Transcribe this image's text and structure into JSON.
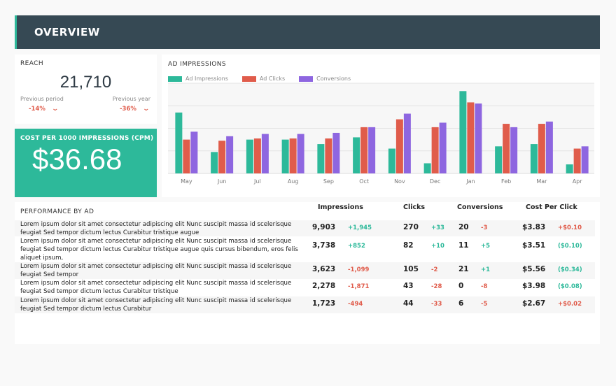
{
  "header": {
    "title": "OVERVIEW"
  },
  "reach": {
    "label": "REACH",
    "value": "21,710",
    "previous_period_label": "Previous period",
    "previous_period_change": "-14%",
    "previous_year_label": "Previous year",
    "previous_year_change": "-36%",
    "trend_icon": "chevron-down-icon"
  },
  "cpm": {
    "label": "COST PER 1000 IMPRESSIONS (CPM)",
    "value": "$36.68"
  },
  "colors": {
    "impressions": "#2db99a",
    "clicks": "#e05c4b",
    "conversions": "#8e66e0",
    "header_bg": "#364954",
    "negative": "#e05c4b",
    "positive": "#2db99a"
  },
  "chart_data": {
    "type": "bar",
    "title": "AD IMPRESSIONS",
    "xlabel": "",
    "ylabel": "",
    "categories": [
      "May",
      "Jun",
      "Jul",
      "Aug",
      "Sep",
      "Oct",
      "Nov",
      "Dec",
      "Jan",
      "Feb",
      "Mar",
      "Apr"
    ],
    "series": [
      {
        "name": "Ad Impressions",
        "color": "#2db99a",
        "values": [
          2.7,
          0.95,
          1.5,
          1.5,
          1.3,
          1.6,
          1.1,
          0.45,
          3.65,
          1.2,
          1.3,
          0.4
        ]
      },
      {
        "name": "Ad Clicks",
        "color": "#e05c4b",
        "values": [
          1.5,
          1.45,
          1.55,
          1.55,
          1.55,
          2.05,
          2.4,
          2.05,
          3.15,
          2.2,
          2.2,
          1.1
        ]
      },
      {
        "name": "Conversions",
        "color": "#8e66e0",
        "values": [
          1.85,
          1.65,
          1.75,
          1.75,
          1.8,
          2.05,
          2.65,
          2.25,
          3.1,
          2.05,
          2.3,
          1.2
        ]
      }
    ],
    "ylim": [
      0,
      4
    ],
    "y_ticks_shown": false,
    "grid": true,
    "legend": "top-left"
  },
  "performance": {
    "label": "PERFORMANCE BY AD",
    "columns": [
      "Impressions",
      "Clicks",
      "Conversions",
      "Cost Per Click"
    ],
    "rows": [
      {
        "description": "Lorem ipsum dolor sit amet consectetur adipiscing elit Nunc suscipit massa id scelerisque feugiat Sed tempor dictum lectus Curabitur tristique augue",
        "impressions": "9,903",
        "impressions_change": "+1,945",
        "impressions_trend": "pos",
        "clicks": "270",
        "clicks_change": "+33",
        "clicks_trend": "pos",
        "conversions": "20",
        "conversions_change": "-3",
        "conversions_trend": "neg",
        "cpc": "$3.83",
        "cpc_change": "+$0.10",
        "cpc_trend": "neg"
      },
      {
        "description": "Lorem ipsum dolor sit amet consectetur adipiscing elit Nunc suscipit massa id scelerisque feugiat Sed tempor dictum lectus Curabitur tristique augue quis cursus bibendum, eros felis aliquet ipsum,",
        "impressions": "3,738",
        "impressions_change": "+852",
        "impressions_trend": "pos",
        "clicks": "82",
        "clicks_change": "+10",
        "clicks_trend": "pos",
        "conversions": "11",
        "conversions_change": "+5",
        "conversions_trend": "pos",
        "cpc": "$3.51",
        "cpc_change": "($0.10)",
        "cpc_trend": "pos"
      },
      {
        "description": "Lorem ipsum dolor sit amet consectetur adipiscing elit Nunc suscipit massa id scelerisque feugiat Sed tempor",
        "impressions": "3,623",
        "impressions_change": "-1,099",
        "impressions_trend": "neg",
        "clicks": "105",
        "clicks_change": "-2",
        "clicks_trend": "neg",
        "conversions": "21",
        "conversions_change": "+1",
        "conversions_trend": "pos",
        "cpc": "$5.56",
        "cpc_change": "($0.34)",
        "cpc_trend": "pos"
      },
      {
        "description": "Lorem ipsum dolor sit amet consectetur adipiscing elit Nunc suscipit massa id scelerisque feugiat Sed tempor dictum lectus Curabitur tristique",
        "impressions": "2,278",
        "impressions_change": "-1,871",
        "impressions_trend": "neg",
        "clicks": "43",
        "clicks_change": "-28",
        "clicks_trend": "neg",
        "conversions": "0",
        "conversions_change": "-8",
        "conversions_trend": "neg",
        "cpc": "$3.98",
        "cpc_change": "($0.08)",
        "cpc_trend": "pos"
      },
      {
        "description": "Lorem ipsum dolor sit amet consectetur adipiscing elit Nunc suscipit massa id scelerisque feugiat Sed tempor dictum lectus Curabitur",
        "impressions": "1,723",
        "impressions_change": "-494",
        "impressions_trend": "neg",
        "clicks": "44",
        "clicks_change": "-33",
        "clicks_trend": "neg",
        "conversions": "6",
        "conversions_change": "-5",
        "conversions_trend": "neg",
        "cpc": "$2.67",
        "cpc_change": "+$0.02",
        "cpc_trend": "neg"
      }
    ]
  }
}
